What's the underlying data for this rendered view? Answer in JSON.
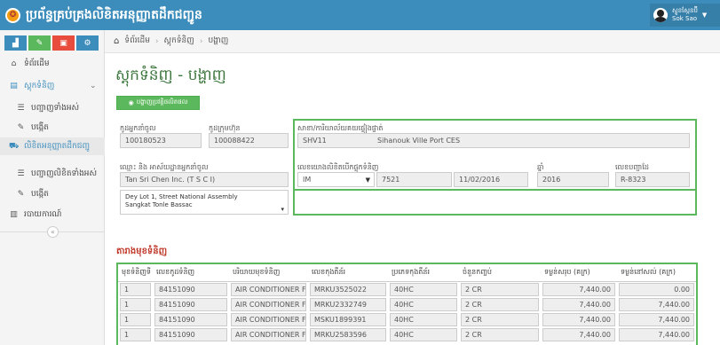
{
  "app": {
    "title": "ប្រព័ន្ធគ្រប់គ្រងលិខិតអនុញ្ញាតដឹកជញ្ជូន",
    "logo_icon": "seal-icon"
  },
  "user": {
    "role": "ស្ទូខស្កែនប៊ី",
    "name": "Sok Sao"
  },
  "toolbar": {
    "buttons": [
      {
        "icon": "chart-icon",
        "color": "#3c8dbc"
      },
      {
        "icon": "pencil-icon",
        "color": "#5cb85c"
      },
      {
        "icon": "gift-icon",
        "color": "#e74c3c"
      },
      {
        "icon": "cogs-icon",
        "color": "#3c8dbc"
      }
    ]
  },
  "sidebar": {
    "items": [
      {
        "label": "ទំព័រដើម",
        "icon": "home-icon"
      },
      {
        "label": "ស្តុកទំនិញ",
        "icon": "database-icon",
        "chevron": "⌄"
      },
      {
        "label": "បញ្ជាញទាំងអស់",
        "icon": "list-icon"
      },
      {
        "label": "បង្កើត",
        "icon": "pen-icon"
      },
      {
        "label": "លិខិតអនុញ្ញាតដឹកជញ្ជូ",
        "icon": "truck-icon"
      },
      {
        "label": "បញ្ជាញលិខិតទាំងអស់",
        "icon": "list-icon"
      },
      {
        "label": "បង្កើត",
        "icon": "pen-icon"
      },
      {
        "label": "របាយការណ៍",
        "icon": "report-icon"
      }
    ],
    "collapse_icon": "«"
  },
  "breadcrumb": {
    "home": "ទំព័រដើម",
    "level2": "ស្តុកទំនិញ",
    "current": "បង្ហាញ",
    "sep": "›"
  },
  "page": {
    "title": "ស្តុកទំនិញ - បង្ហាញ",
    "action_button": "បង្ហាញប្រវត្តិផលិតផល"
  },
  "form": {
    "importer_code_label": "កូដអ្នកនាំចូល",
    "importer_code": "100180523",
    "company_code_label": "កូដក្រុមហ៊ុន",
    "company_code": "100088422",
    "customs_label": "សាខា/ការិយាល័យគយផ្ទៀងផ្ទាត់",
    "customs_code": "SHV11",
    "customs_name": "Sihanouk Ville Port CES",
    "importer_name_label": "ឈ្មោះ និង អាស័យដ្ឋានអ្នកនាំចូល",
    "importer_name": "Tan Sri Chen Inc. (T S C I)",
    "address_lines": [
      "Dey Lot 1, Street National Assembly",
      "Sangkat Tonle Bassac"
    ],
    "declaration_label": "លេខយោងលិខិតបើកផ្ទុកទំនិញ",
    "declaration_type": "IM",
    "declaration_number": "7521",
    "declaration_date": "11/02/2016",
    "year_label": "ឆ្នាំ",
    "year": "2016",
    "register_label": "លេខបញ្ជាដែ",
    "register_no": "R-8323"
  },
  "goods": {
    "section_title": "តារាងមុខទំនិញ",
    "columns": [
      "មុខទំនិញទី",
      "លេខកូដទំនិញ",
      "បរិយាយមុខទំនិញ",
      "លេខកុងតឺន័រ",
      "ប្រភេទកុងតឺន័រ",
      "ចំនួនកញ្ចប់",
      "ទម្ងន់សរុប (គក្រ)",
      "ទម្ងន់នៅសល់ (គក្រ)"
    ],
    "rows": [
      [
        "1",
        "84151090",
        "AIR CONDITIONER F",
        "MRKU3525022",
        "40HC",
        "2 CR",
        "7,440.00",
        "0.00"
      ],
      [
        "1",
        "84151090",
        "AIR CONDITIONER F",
        "MRKU2332749",
        "40HC",
        "2 CR",
        "7,440.00",
        "7,440.00"
      ],
      [
        "1",
        "84151090",
        "AIR CONDITIONER F",
        "MSKU1899391",
        "40HC",
        "2 CR",
        "7,440.00",
        "7,440.00"
      ],
      [
        "1",
        "84151090",
        "AIR CONDITIONER F",
        "MRKU2583596",
        "40HC",
        "2 CR",
        "7,440.00",
        "7,440.00"
      ]
    ]
  },
  "colors": {
    "header": "#3c8dbc",
    "accent_green": "#5cb85c",
    "title_green": "#3c763d",
    "section_red": "#c0392b"
  }
}
